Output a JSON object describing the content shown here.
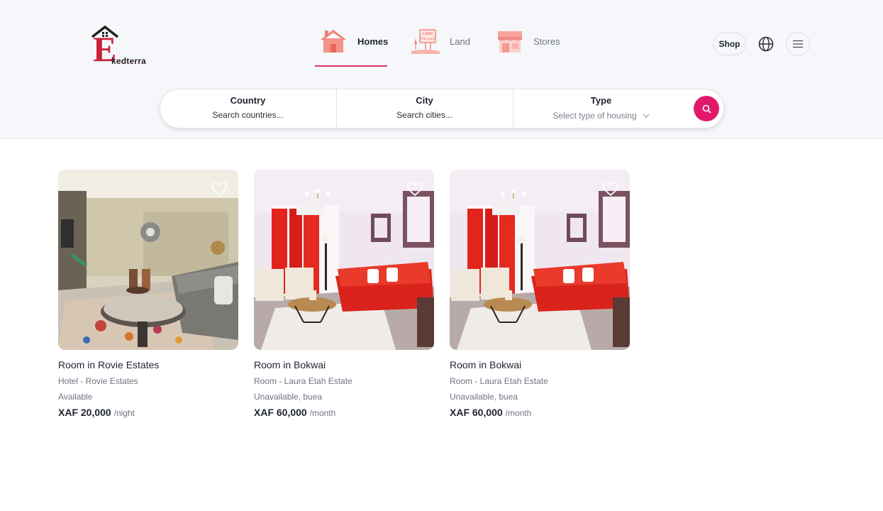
{
  "brand": {
    "name": "kedterra",
    "initial": "E"
  },
  "categories": [
    {
      "label": "Homes",
      "icon": "house-icon",
      "active": true
    },
    {
      "label": "Land",
      "icon": "land-for-sale-sign-icon",
      "active": false,
      "sign_text": "LAND FOR SALE"
    },
    {
      "label": "Stores",
      "icon": "storefront-icon",
      "active": false
    }
  ],
  "header_actions": {
    "shop_label": "Shop",
    "language_icon": "globe-icon",
    "menu_icon": "hamburger-menu-icon"
  },
  "search": {
    "country": {
      "title": "Country",
      "placeholder": "Search countries..."
    },
    "city": {
      "title": "City",
      "placeholder": "Search cities..."
    },
    "type": {
      "title": "Type",
      "placeholder": "Select type of housing"
    },
    "button_icon": "search-icon"
  },
  "listings": [
    {
      "title": "Room in Rovie Estates",
      "subtitle": "Hotel - Rovie Estates",
      "status": "Available",
      "price": "XAF 20,000",
      "period": "/night",
      "photo": "living-room-grey-sofa"
    },
    {
      "title": "Room in Bokwai",
      "subtitle": "Room - Laura Etah Estate",
      "status": "Unavailable, buea",
      "price": "XAF 60,000",
      "period": "/month",
      "photo": "living-room-red-sofa"
    },
    {
      "title": "Room in Bokwai",
      "subtitle": "Room - Laura Etah Estate",
      "status": "Unavailable, buea",
      "price": "XAF 60,000",
      "period": "/month",
      "photo": "living-room-red-sofa"
    }
  ],
  "colors": {
    "accent": "#e0196a",
    "brand_red": "#c8213a",
    "icon_pink": "#f08a84",
    "header_bg": "#f6f7fa"
  }
}
